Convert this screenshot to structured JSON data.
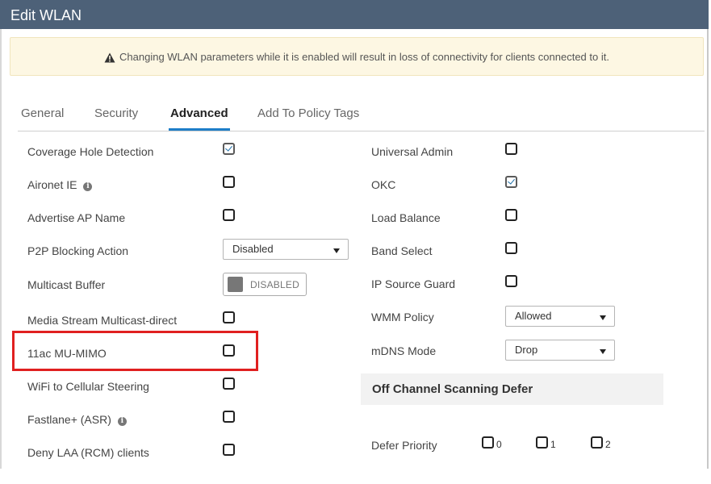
{
  "title": "Edit WLAN",
  "warning": "Changing WLAN parameters while it is enabled will result in loss of connectivity for clients connected to it.",
  "tabs": [
    "General",
    "Security",
    "Advanced",
    "Add To Policy Tags"
  ],
  "active_tab": "Advanced",
  "left": {
    "coverage_hole_detection": {
      "label": "Coverage Hole Detection",
      "checked": true
    },
    "aironet_ie": {
      "label": "Aironet IE",
      "checked": false
    },
    "advertise_ap_name": {
      "label": "Advertise AP Name",
      "checked": false
    },
    "p2p_blocking_action": {
      "label": "P2P Blocking Action",
      "value": "Disabled"
    },
    "multicast_buffer": {
      "label": "Multicast Buffer",
      "value": "DISABLED"
    },
    "media_stream": {
      "label": "Media Stream Multicast-direct",
      "checked": false
    },
    "mu_mimo": {
      "label": "11ac MU-MIMO",
      "checked": false
    },
    "wifi_cellular": {
      "label": "WiFi to Cellular Steering",
      "checked": false
    },
    "fastlane": {
      "label": "Fastlane+ (ASR)",
      "checked": false
    },
    "deny_laa": {
      "label": "Deny LAA (RCM) clients",
      "checked": false
    }
  },
  "right": {
    "universal_admin": {
      "label": "Universal Admin",
      "checked": false
    },
    "okc": {
      "label": "OKC",
      "checked": true
    },
    "load_balance": {
      "label": "Load Balance",
      "checked": false
    },
    "band_select": {
      "label": "Band Select",
      "checked": false
    },
    "ip_source_guard": {
      "label": "IP Source Guard",
      "checked": false
    },
    "wmm_policy": {
      "label": "WMM Policy",
      "value": "Allowed"
    },
    "mdns_mode": {
      "label": "mDNS Mode",
      "value": "Drop"
    }
  },
  "off_channel": {
    "heading": "Off Channel Scanning Defer",
    "defer_priority_label": "Defer Priority",
    "priorities": [
      "0",
      "1",
      "2"
    ]
  },
  "colors": {
    "titlebar": "#4d6178",
    "accent": "#1e7ec8",
    "highlight": "#e02020",
    "warning_bg": "#fdf7e3"
  },
  "icons": {
    "warning": "warning-triangle-icon",
    "info": "info-icon"
  }
}
